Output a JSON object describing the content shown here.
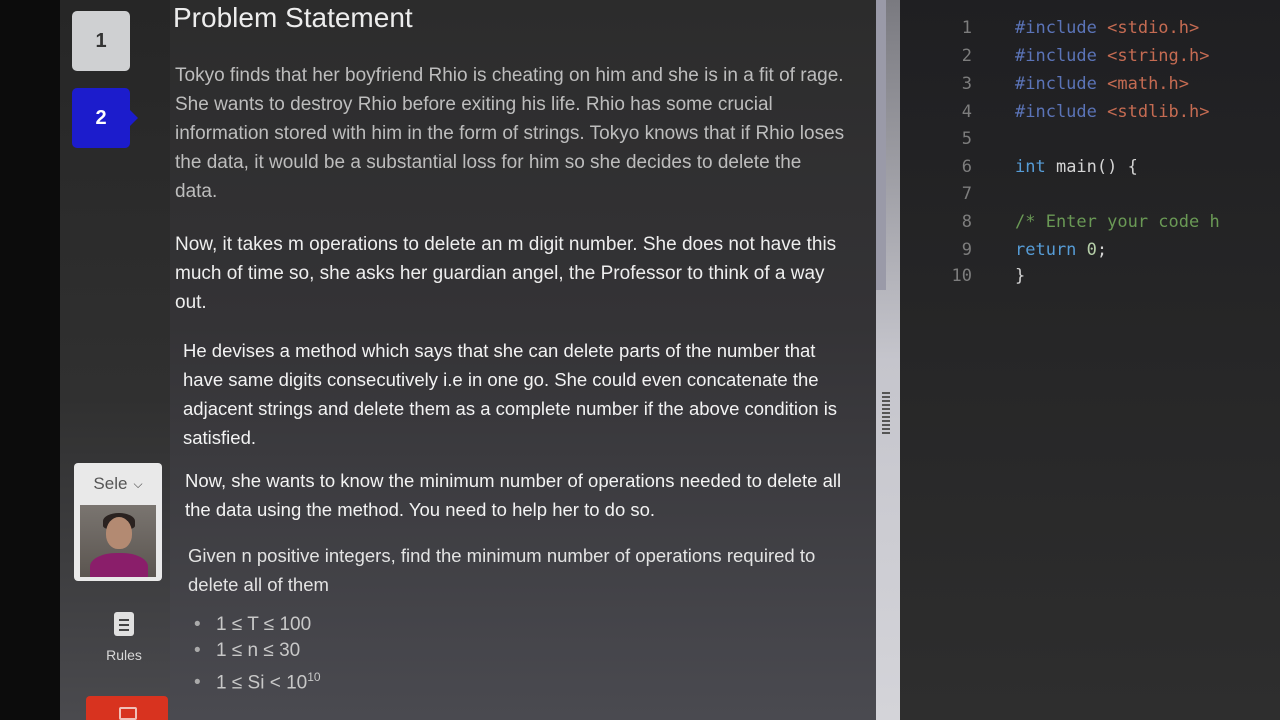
{
  "sidebar": {
    "questions": [
      {
        "number": "1",
        "active": false
      },
      {
        "number": "2",
        "active": true
      }
    ],
    "camera_select_label": "Sele",
    "rules_label": "Rules",
    "accent_color": "#1c1ccc",
    "icons": [
      "chevron-down-icon",
      "clipboard-icon",
      "exit-icon"
    ]
  },
  "problem": {
    "title": "Problem Statement",
    "paragraphs": [
      "Tokyo finds that her boyfriend Rhio is cheating on him and she is in a fit of rage. She wants to destroy Rhio before exiting his life. Rhio has some crucial information stored with him in the form of strings. Tokyo knows that if Rhio loses the data, it would be a substantial loss for him so she decides to delete the data.",
      "Now, it takes m operations to delete an m digit number. She does not have this much of time so, she asks her guardian angel, the Professor to think of a way out.",
      "He devises a method which says that she can delete parts of the number that have same digits consecutively i.e in one go. She could even concatenate the adjacent strings and delete them as a complete number if the above condition is satisfied.",
      "Now, she wants to know the minimum number of operations needed to delete all the data using the method. You need to help her to do so.",
      "Given n positive integers, find the minimum number of operations required to delete all of them"
    ],
    "constraints": [
      {
        "text": "1 ≤ T ≤ 100",
        "sup": ""
      },
      {
        "text": "1 ≤ n ≤ 30",
        "sup": ""
      },
      {
        "text": "1 ≤ Si < 10",
        "sup": "10"
      }
    ]
  },
  "editor": {
    "lines": [
      {
        "n": "1",
        "parts": [
          [
            "pp",
            "#include "
          ],
          [
            "hdr",
            "<stdio.h>"
          ]
        ]
      },
      {
        "n": "2",
        "parts": [
          [
            "pp",
            "#include "
          ],
          [
            "hdr",
            "<string.h>"
          ]
        ]
      },
      {
        "n": "3",
        "parts": [
          [
            "pp",
            "#include "
          ],
          [
            "hdr",
            "<math.h>"
          ]
        ]
      },
      {
        "n": "4",
        "parts": [
          [
            "pp",
            "#include "
          ],
          [
            "hdr",
            "<stdlib.h>"
          ]
        ]
      },
      {
        "n": "5",
        "parts": []
      },
      {
        "n": "6",
        "parts": [
          [
            "kw",
            "int"
          ],
          [
            "plain",
            " main() {"
          ]
        ]
      },
      {
        "n": "7",
        "parts": []
      },
      {
        "n": "8",
        "parts": [
          [
            "cm",
            "    /* Enter your code h"
          ]
        ]
      },
      {
        "n": "9",
        "parts": [
          [
            "kw",
            "    return"
          ],
          [
            "plain",
            " "
          ],
          [
            "num",
            "0"
          ],
          [
            "plain",
            ";"
          ]
        ]
      },
      {
        "n": "10",
        "parts": [
          [
            "plain",
            "}"
          ]
        ]
      }
    ]
  }
}
